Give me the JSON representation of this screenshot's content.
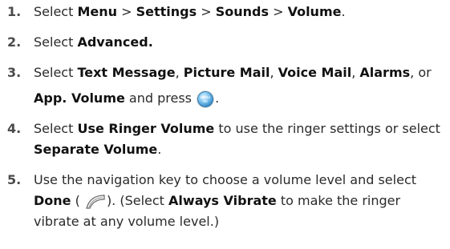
{
  "steps": [
    {
      "num": "1.",
      "parts": {
        "t0": "Select ",
        "b0": "Menu",
        "t1": " > ",
        "b1": "Settings",
        "t2": " > ",
        "b2": "Sounds",
        "t3": " > ",
        "b3": "Volume",
        "t4": "."
      }
    },
    {
      "num": "2.",
      "parts": {
        "t0": "Select ",
        "b0": "Advanced."
      }
    },
    {
      "num": "3.",
      "parts": {
        "t0": "Select ",
        "b0": "Text Message",
        "t1": ", ",
        "b1": "Picture Mail",
        "t2": ", ",
        "b2": "Voice Mail",
        "t3": ", ",
        "b3": "Alarms",
        "t4": ", or",
        "b4": "App. Volume",
        "t5": " and press ",
        "t6": "."
      }
    },
    {
      "num": "4.",
      "parts": {
        "t0": "Select ",
        "b0": "Use Ringer Volume",
        "t1": " to use the ringer settings or select ",
        "b1": "Separate Volume",
        "t2": "."
      }
    },
    {
      "num": "5.",
      "parts": {
        "t0": "Use the navigation key to choose a volume level and select ",
        "b0": "Done",
        "t1": " (",
        "t2": "). (Select ",
        "b1": "Always Vibrate",
        "t3": " to make the ringer vibrate at any volume level.)"
      }
    }
  ],
  "icons": {
    "menu_ok": {
      "line1": "MENU",
      "line2": "OK"
    }
  }
}
